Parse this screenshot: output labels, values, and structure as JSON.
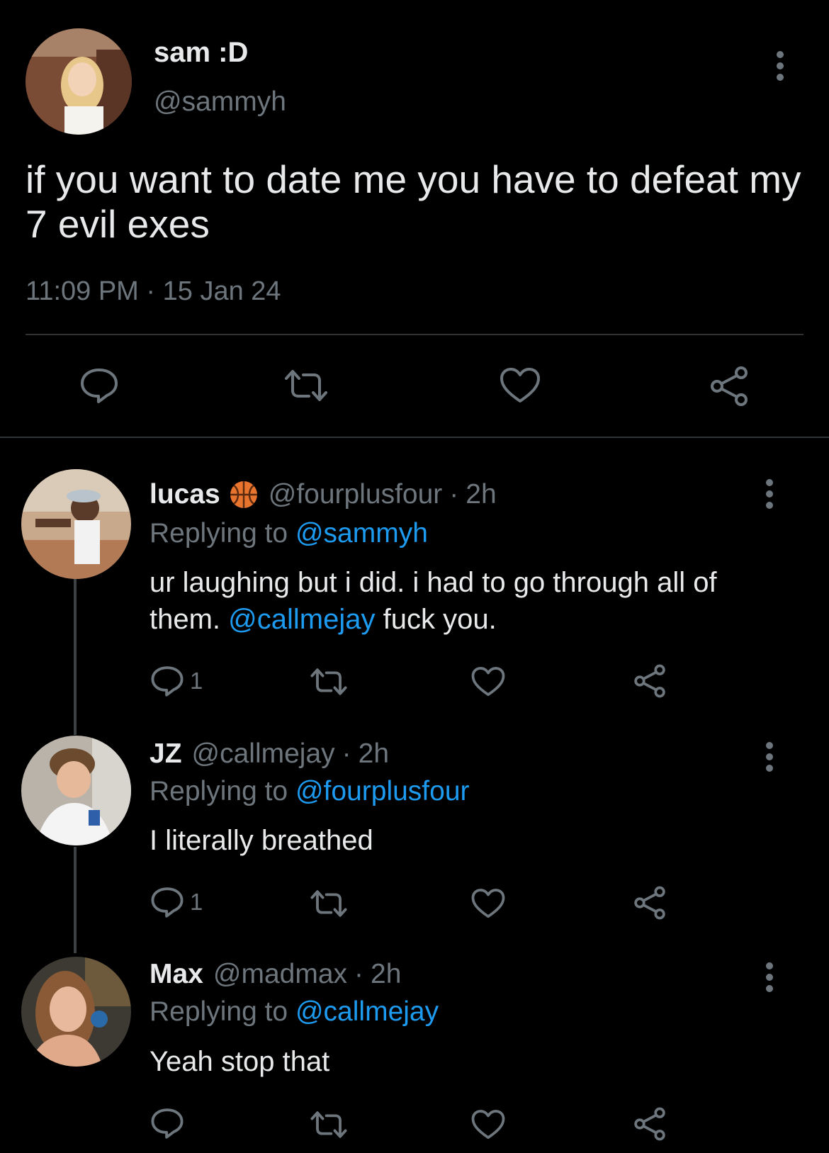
{
  "main_tweet": {
    "display_name": "sam :D",
    "handle": "@sammyh",
    "text": "if you want to date me you have to defeat my 7 evil exes",
    "time": "11:09 PM",
    "separator": "·",
    "date": "15 Jan 24",
    "actions": [
      "reply-icon",
      "retweet-icon",
      "like-icon",
      "share-icon"
    ]
  },
  "replies": [
    {
      "display_name": "lucas",
      "emoji": "basketball-emoji",
      "handle": "@fourplusfour",
      "separator": "·",
      "time": "2h",
      "replying_prefix": "Replying to",
      "replying_to": "@sammyh",
      "text_part1": "ur laughing but i did. i had to go through all of them.",
      "mention": "@callmejay",
      "text_part2": "fuck you.",
      "reply_count": "1"
    },
    {
      "display_name": "JZ",
      "handle": "@callmejay",
      "separator": "·",
      "time": "2h",
      "replying_prefix": "Replying to",
      "replying_to": "@fourplusfour",
      "text": "I literally breathed",
      "reply_count": "1"
    },
    {
      "display_name": "Max",
      "handle": "@madmax",
      "separator": "·",
      "time": "2h",
      "replying_prefix": "Replying to",
      "replying_to": "@callmejay",
      "text": "Yeah stop that",
      "reply_count": ""
    }
  ],
  "colors": {
    "background": "#000000",
    "text": "#e7e9ea",
    "muted": "#6e767d",
    "link": "#1d9bf0",
    "divider": "#2f3336"
  }
}
